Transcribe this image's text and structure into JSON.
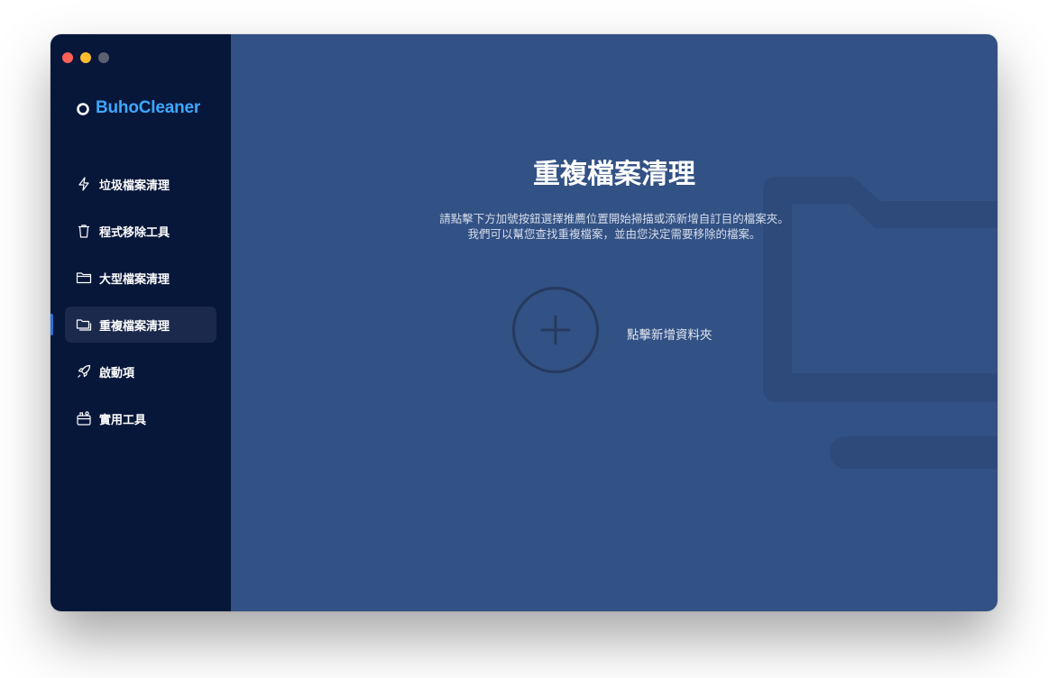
{
  "app": {
    "name": "BuhoCleaner",
    "brand_color": "#3ea6ff"
  },
  "window_controls": {
    "close": "close-button",
    "minimize": "minimize-button",
    "maximize": "maximize-button"
  },
  "sidebar": {
    "items": [
      {
        "label": "垃圾檔案清理",
        "icon": "lightning-icon",
        "active": false
      },
      {
        "label": "程式移除工具",
        "icon": "trash-icon",
        "active": false
      },
      {
        "label": "大型檔案清理",
        "icon": "folder-icon",
        "active": false
      },
      {
        "label": "重複檔案清理",
        "icon": "duplicate-folder-icon",
        "active": true
      },
      {
        "label": "啟動項",
        "icon": "rocket-icon",
        "active": false
      },
      {
        "label": "實用工具",
        "icon": "toolbox-icon",
        "active": false
      }
    ]
  },
  "main": {
    "title": "重複檔案清理",
    "description_line1": "請點擊下方加號按鈕選擇推薦位置開始掃描或添新增自訂目的檔案夾。",
    "description_line2": "我們可以幫您查找重複檔案，並由您決定需要移除的檔案。",
    "add_folder_label": "點擊新增資料夾",
    "add_icon": "plus-icon"
  },
  "colors": {
    "sidebar_bg": "#07173a",
    "main_bg": "#325184",
    "active_item_bg": "#1b2a4c"
  }
}
